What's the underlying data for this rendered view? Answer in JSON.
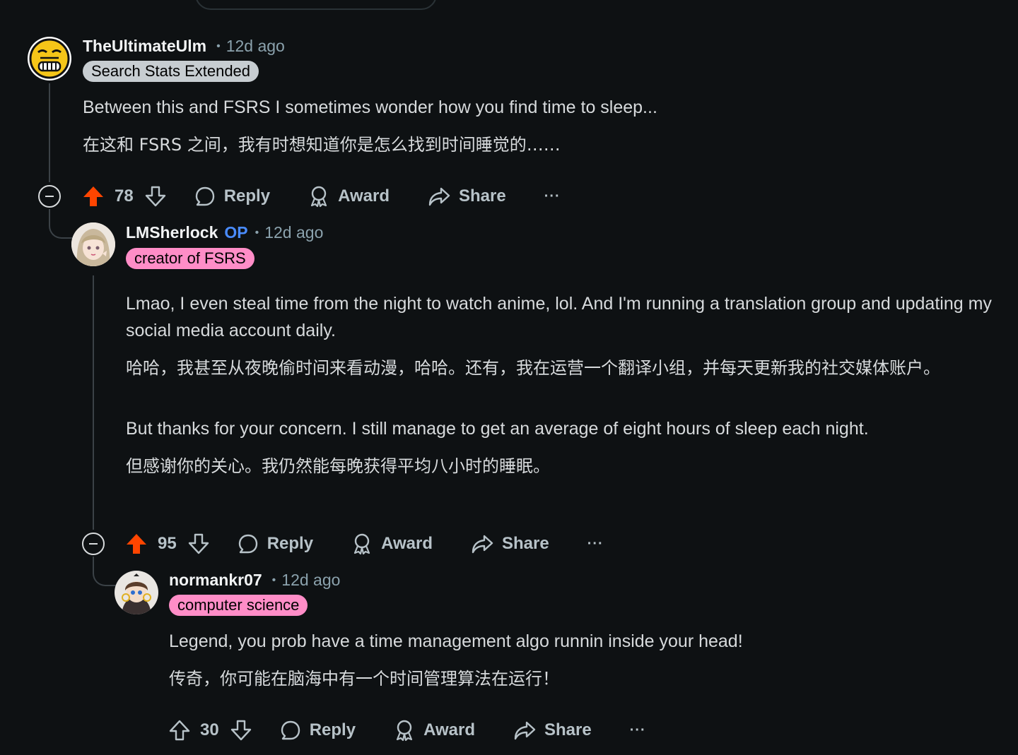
{
  "comments": [
    {
      "author": "TheUltimateUlm",
      "op": "",
      "time": "12d ago",
      "flair": "Search Stats Extended",
      "body_en": "Between this and FSRS I sometimes wonder how you find time to sleep...",
      "body_zh": "在这和 FSRS 之间，我有时想知道你是怎么找到时间睡觉的……",
      "votes": "78",
      "upvoted": true
    },
    {
      "author": "LMSherlock",
      "op": "OP",
      "time": "12d ago",
      "flair": "creator of FSRS",
      "body_en_1": "Lmao, I even steal time from the night to watch anime, lol. And I'm running a translation group and updating my social media account daily.",
      "body_zh_1": "哈哈，我甚至从夜晚偷时间来看动漫，哈哈。还有，我在运营一个翻译小组，并每天更新我的社交媒体账户。",
      "body_en_2": "But thanks for your concern. I still manage to get an average of eight hours of sleep each night.",
      "body_zh_2": "但感谢你的关心。我仍然能每晚获得平均八小时的睡眠。",
      "votes": "95",
      "upvoted": true
    },
    {
      "author": "normankr07",
      "op": "",
      "time": "12d ago",
      "flair": "computer science",
      "body_en": "Legend, you prob have a time management algo runnin inside your head!",
      "body_zh": "传奇，你可能在脑海中有一个时间管理算法在运行！",
      "votes": "30",
      "upvoted": false
    }
  ],
  "labels": {
    "reply": "Reply",
    "award": "Award",
    "share": "Share",
    "more": "···"
  },
  "colors": {
    "background": "#0e1113",
    "upvote_active": "#ff4500",
    "op": "#4a8cff",
    "flair_gray": "#c7cdd1",
    "flair_pink": "#ff8dc7"
  }
}
